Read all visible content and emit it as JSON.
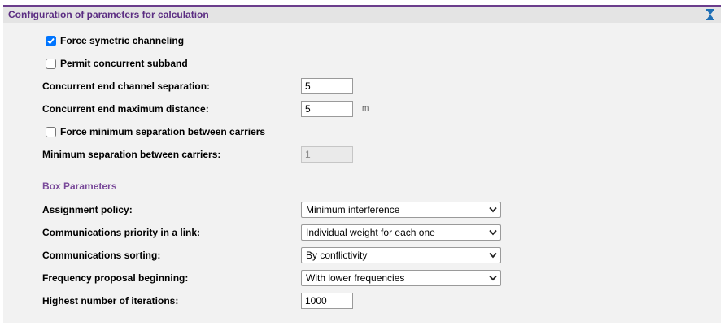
{
  "header": {
    "title": "Configuration of parameters for calculation",
    "collapse_icon": "collapse-hourglass-icon"
  },
  "checkboxes": {
    "force_symmetric": {
      "label": "Force symetric channeling",
      "checked": true
    },
    "permit_concurrent": {
      "label": "Permit concurrent subband",
      "checked": false
    },
    "force_min_sep": {
      "label": "Force minimum separation between carriers",
      "checked": false
    }
  },
  "fields": {
    "concurrent_separation": {
      "label": "Concurrent end channel separation:",
      "value": "5"
    },
    "concurrent_distance": {
      "label": "Concurrent end maximum distance:",
      "value": "5",
      "unit": "m"
    },
    "min_separation": {
      "label": "Minimum separation between carriers:",
      "value": "1",
      "disabled": true
    }
  },
  "box": {
    "title": "Box Parameters",
    "assignment_policy": {
      "label": "Assignment policy:",
      "value": "Minimum interference"
    },
    "priority": {
      "label": "Communications priority in a link:",
      "value": "Individual weight for each one"
    },
    "sorting": {
      "label": "Communications sorting:",
      "value": "By conflictivity"
    },
    "freq_begin": {
      "label": "Frequency proposal beginning:",
      "value": "With lower frequencies"
    },
    "iterations": {
      "label": "Highest number of iterations:",
      "value": "1000"
    }
  },
  "colors": {
    "accent": "#5b2d82",
    "header_bg": "#e4e4e4",
    "panel_bg": "#f2f2f2",
    "checkbox_on": "#0075ff"
  }
}
